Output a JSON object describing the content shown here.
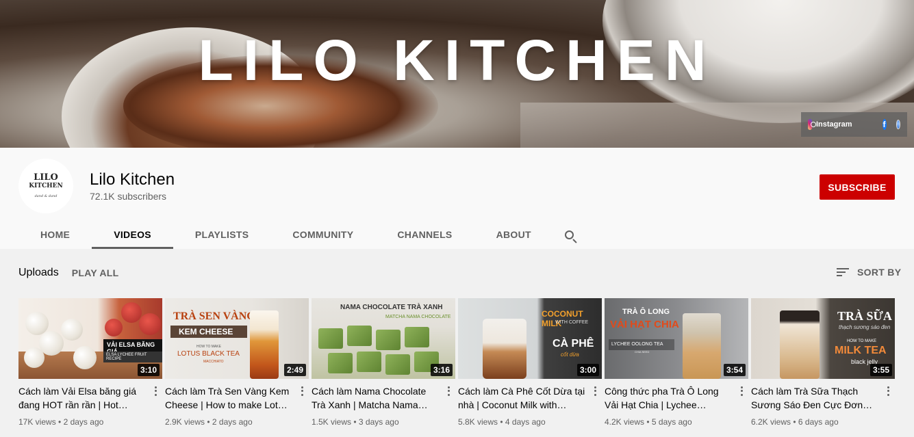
{
  "banner": {
    "title": "LILO KITCHEN",
    "links": {
      "instagram_label": "Instagram"
    }
  },
  "channel": {
    "avatar_text_1": "LILO",
    "avatar_text_2": "KITCHEN",
    "avatar_sub": "dand & dand",
    "name": "Lilo Kitchen",
    "subscribers": "72.1K subscribers",
    "subscribe_label": "SUBSCRIBE",
    "subscribe_color": "#cc0000"
  },
  "tabs": [
    {
      "label": "HOME"
    },
    {
      "label": "VIDEOS",
      "active": true
    },
    {
      "label": "PLAYLISTS"
    },
    {
      "label": "COMMUNITY"
    },
    {
      "label": "CHANNELS"
    },
    {
      "label": "ABOUT"
    }
  ],
  "section": {
    "title": "Uploads",
    "play_all": "PLAY ALL",
    "sort_by": "SORT BY"
  },
  "videos": [
    {
      "title": "Cách làm Vải Elsa băng giá đang HOT rần rần | Hot…",
      "duration": "3:10",
      "views": "17K views",
      "age": "2 days ago",
      "thumb_text": [
        "VẢI ELSA BĂNG GIÁ",
        "ELSA LYCHEE FRUIT RECIPE"
      ]
    },
    {
      "title": "Cách làm Trà Sen Vàng Kem Cheese | How to make Lot…",
      "duration": "2:49",
      "views": "2.9K views",
      "age": "2 days ago",
      "thumb_text": [
        "TRÀ SEN VÀNG",
        "KEM CHEESE",
        "HOW TO MAKE",
        "LOTUS BLACK TEA",
        "MACCHIATO"
      ]
    },
    {
      "title": "Cách làm Nama Chocolate Trà Xanh | Matcha Nama…",
      "duration": "3:16",
      "views": "1.5K views",
      "age": "3 days ago",
      "thumb_text": [
        "NAMA CHOCOLATE TRÀ XANH",
        "MATCHA NAMA CHOCOLATE"
      ]
    },
    {
      "title": "Cách làm Cà Phê Cốt Dừa tại nhà | Coconut Milk with…",
      "duration": "3:00",
      "views": "5.8K views",
      "age": "4 days ago",
      "thumb_text": [
        "COCONUT MILK",
        "WITH COFFEE",
        "CÀ PHÊ",
        "cốt dừa"
      ]
    },
    {
      "title": "Công thức pha Trà Ô Long Vải Hạt Chia | Lychee…",
      "duration": "3:54",
      "views": "4.2K views",
      "age": "5 days ago",
      "thumb_text": [
        "TRÀ Ô LONG",
        "VẢI HẠT CHIA",
        "LYCHEE OOLONG TEA",
        "CHIA SEED"
      ]
    },
    {
      "title": "Cách làm Trà Sữa Thạch Sương Sáo Đen Cực Đơn…",
      "duration": "3:55",
      "views": "6.2K views",
      "age": "6 days ago",
      "thumb_text": [
        "TRÀ SỮA",
        "thạch sương sáo đen",
        "HOW TO MAKE",
        "MILK TEA",
        "black jelly"
      ]
    }
  ]
}
